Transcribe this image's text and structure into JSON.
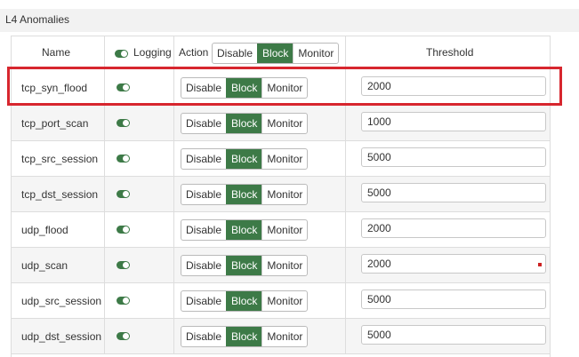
{
  "section": {
    "title": "L4 Anomalies"
  },
  "header": {
    "name": "Name",
    "logging": "Logging",
    "action": "Action",
    "threshold": "Threshold",
    "action_options": [
      "Disable",
      "Block",
      "Monitor"
    ],
    "active_action": "Block"
  },
  "rows": [
    {
      "name": "tcp_syn_flood",
      "logging": true,
      "action_options": [
        "Disable",
        "Block",
        "Monitor"
      ],
      "action": "Block",
      "threshold": "2000",
      "highlighted": true
    },
    {
      "name": "tcp_port_scan",
      "logging": true,
      "action_options": [
        "Disable",
        "Block",
        "Monitor"
      ],
      "action": "Block",
      "threshold": "1000"
    },
    {
      "name": "tcp_src_session",
      "logging": true,
      "action_options": [
        "Disable",
        "Block",
        "Monitor"
      ],
      "action": "Block",
      "threshold": "5000"
    },
    {
      "name": "tcp_dst_session",
      "logging": true,
      "action_options": [
        "Disable",
        "Block",
        "Monitor"
      ],
      "action": "Block",
      "threshold": "5000"
    },
    {
      "name": "udp_flood",
      "logging": true,
      "action_options": [
        "Disable",
        "Block",
        "Monitor"
      ],
      "action": "Block",
      "threshold": "2000"
    },
    {
      "name": "udp_scan",
      "logging": true,
      "action_options": [
        "Disable",
        "Block",
        "Monitor"
      ],
      "action": "Block",
      "threshold": "2000",
      "error_marker": true
    },
    {
      "name": "udp_src_session",
      "logging": true,
      "action_options": [
        "Disable",
        "Block",
        "Monitor"
      ],
      "action": "Block",
      "threshold": "5000"
    },
    {
      "name": "udp_dst_session",
      "logging": true,
      "action_options": [
        "Disable",
        "Block",
        "Monitor"
      ],
      "action": "Block",
      "threshold": "5000"
    }
  ],
  "colors": {
    "accent": "#3d7a47",
    "highlight": "#d7262e",
    "alt_row": "#f5f5f5"
  }
}
